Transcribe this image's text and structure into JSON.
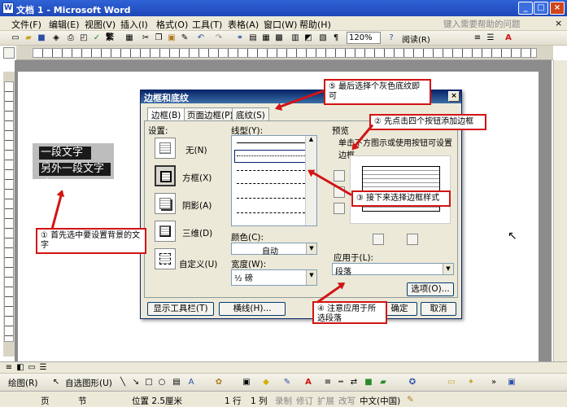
{
  "window": {
    "title": "文档 1 - Microsoft Word",
    "app_icon": "W",
    "minimize": "_",
    "maximize": "□",
    "close": "×"
  },
  "menu": {
    "items": [
      "文件(F)",
      "编辑(E)",
      "视图(V)",
      "插入(I)",
      "格式(O)",
      "工具(T)",
      "表格(A)",
      "窗口(W)",
      "帮助(H)"
    ],
    "help_placeholder": "键入需要帮助的问题",
    "close": "×"
  },
  "toolbar": {
    "zoom": "120%",
    "read_label": "阅读(R)",
    "traditional": "繁"
  },
  "document": {
    "line1": "一段文字",
    "line2": "另外一段文字",
    "para_mark": "↵"
  },
  "dialog": {
    "title": "边框和底纹",
    "tabs": [
      "边框(B)",
      "页面边框(P)",
      "底纹(S)"
    ],
    "settings_label": "设置:",
    "settings": [
      "无(N)",
      "方框(X)",
      "阴影(A)",
      "三维(D)",
      "自定义(U)"
    ],
    "linestyle_label": "线型(Y):",
    "color_label": "颜色(C):",
    "color_value": "自动",
    "width_label": "宽度(W):",
    "width_value": "½ 磅",
    "preview_label": "预览",
    "preview_hint": "单击下方图示或使用按钮可设置边框",
    "apply_label": "应用于(L):",
    "apply_value": "段落",
    "options_btn": "选项(O)...",
    "toolbar_btn": "显示工具栏(T)",
    "hline_btn": "横线(H)...",
    "ok_btn": "确定",
    "cancel_btn": "取消",
    "close": "×"
  },
  "callouts": {
    "c1": "① 首先选中要设置背景的文字",
    "c2": "② 先点击四个按钮添加边框",
    "c3": "③ 接下来选择边框样式",
    "c4": "④ 注意应用于所选段落",
    "c5": "⑤ 最后选择个灰色底纹即可"
  },
  "drawbar": {
    "draw": "绘图(R)",
    "autoshape": "自选图形(U)"
  },
  "status": {
    "page": "页",
    "section": "节",
    "pos": "位置 2.5厘米",
    "line": "1 行",
    "col": "1 列",
    "rec": "录制",
    "trk": "修订",
    "ext": "扩展",
    "ovr": "改写",
    "lang": "中文(中国)"
  },
  "colors": {
    "title": "#1f47b8",
    "callout": "#d21414"
  }
}
